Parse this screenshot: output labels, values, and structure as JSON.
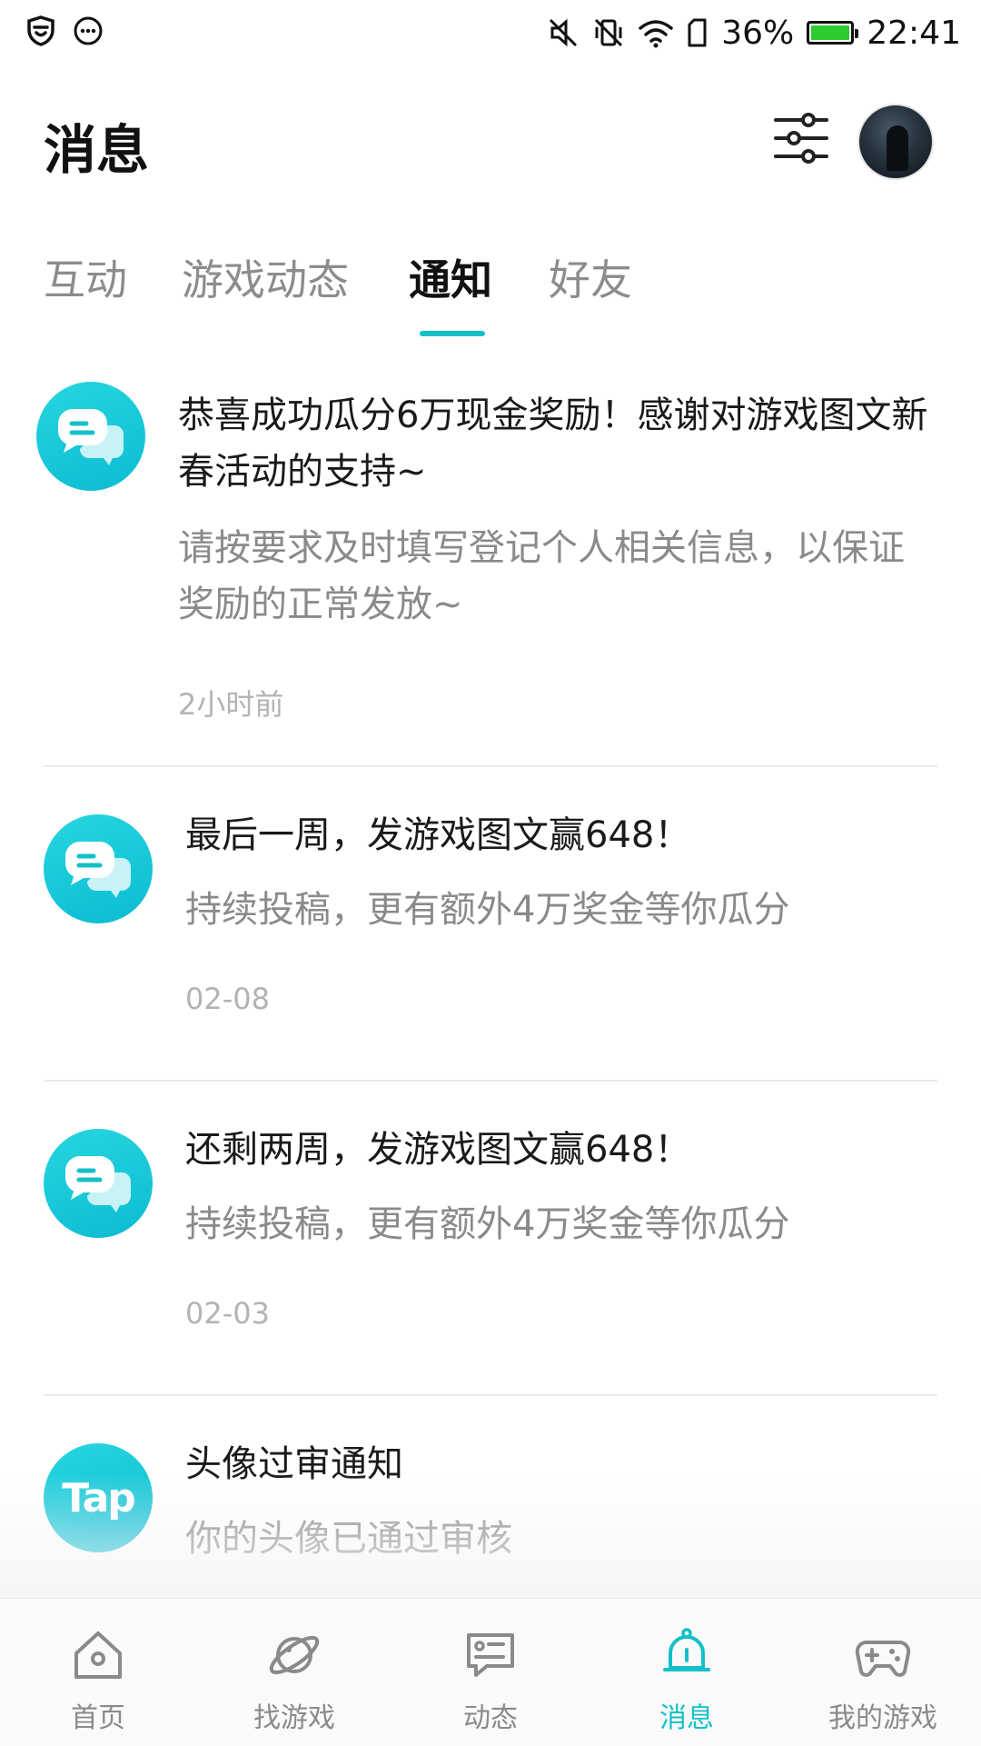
{
  "status_bar": {
    "battery_percent": "36%",
    "battery_level": 1.0,
    "battery_color": "#2ecc2e",
    "time": "22:41",
    "icons": [
      "shield-icon",
      "chat-bubble-icon",
      "mute-icon",
      "vibrate-off-icon",
      "wifi-icon",
      "sim-icon",
      "battery-icon"
    ]
  },
  "header": {
    "title": "消息",
    "filter_icon": "sliders-icon",
    "avatar_icon": "user-avatar"
  },
  "tabs": [
    {
      "label": "互动",
      "active": false
    },
    {
      "label": "游戏动态",
      "active": false
    },
    {
      "label": "通知",
      "active": true
    },
    {
      "label": "好友",
      "active": false
    }
  ],
  "accent_color": "#14c0c7",
  "notifications": [
    {
      "title": "恭喜成功瓜分6万现金奖励！感谢对游戏图文新春活动的支持~",
      "description": "请按要求及时填写登记个人相关信息，以保证奖励的正常发放~",
      "time": "2小时前",
      "icon": "message-bubble-icon"
    },
    {
      "title": "最后一周，发游戏图文赢648！",
      "description": "持续投稿，更有额外4万奖金等你瓜分",
      "time": "02-08",
      "icon": "message-bubble-icon"
    },
    {
      "title": "还剩两周，发游戏图文赢648！",
      "description": "持续投稿，更有额外4万奖金等你瓜分",
      "time": "02-03",
      "icon": "message-bubble-icon"
    },
    {
      "title": "头像过审通知",
      "description": "你的头像已通过审核",
      "icon_text": "Tap",
      "icon": "tap-logo-icon"
    }
  ],
  "bottom_nav": [
    {
      "label": "首页",
      "icon": "home-icon",
      "active": false
    },
    {
      "label": "找游戏",
      "icon": "planet-icon",
      "active": false
    },
    {
      "label": "动态",
      "icon": "feed-icon",
      "active": false
    },
    {
      "label": "消息",
      "icon": "bell-icon",
      "active": true
    },
    {
      "label": "我的游戏",
      "icon": "gamepad-icon",
      "active": false
    }
  ]
}
